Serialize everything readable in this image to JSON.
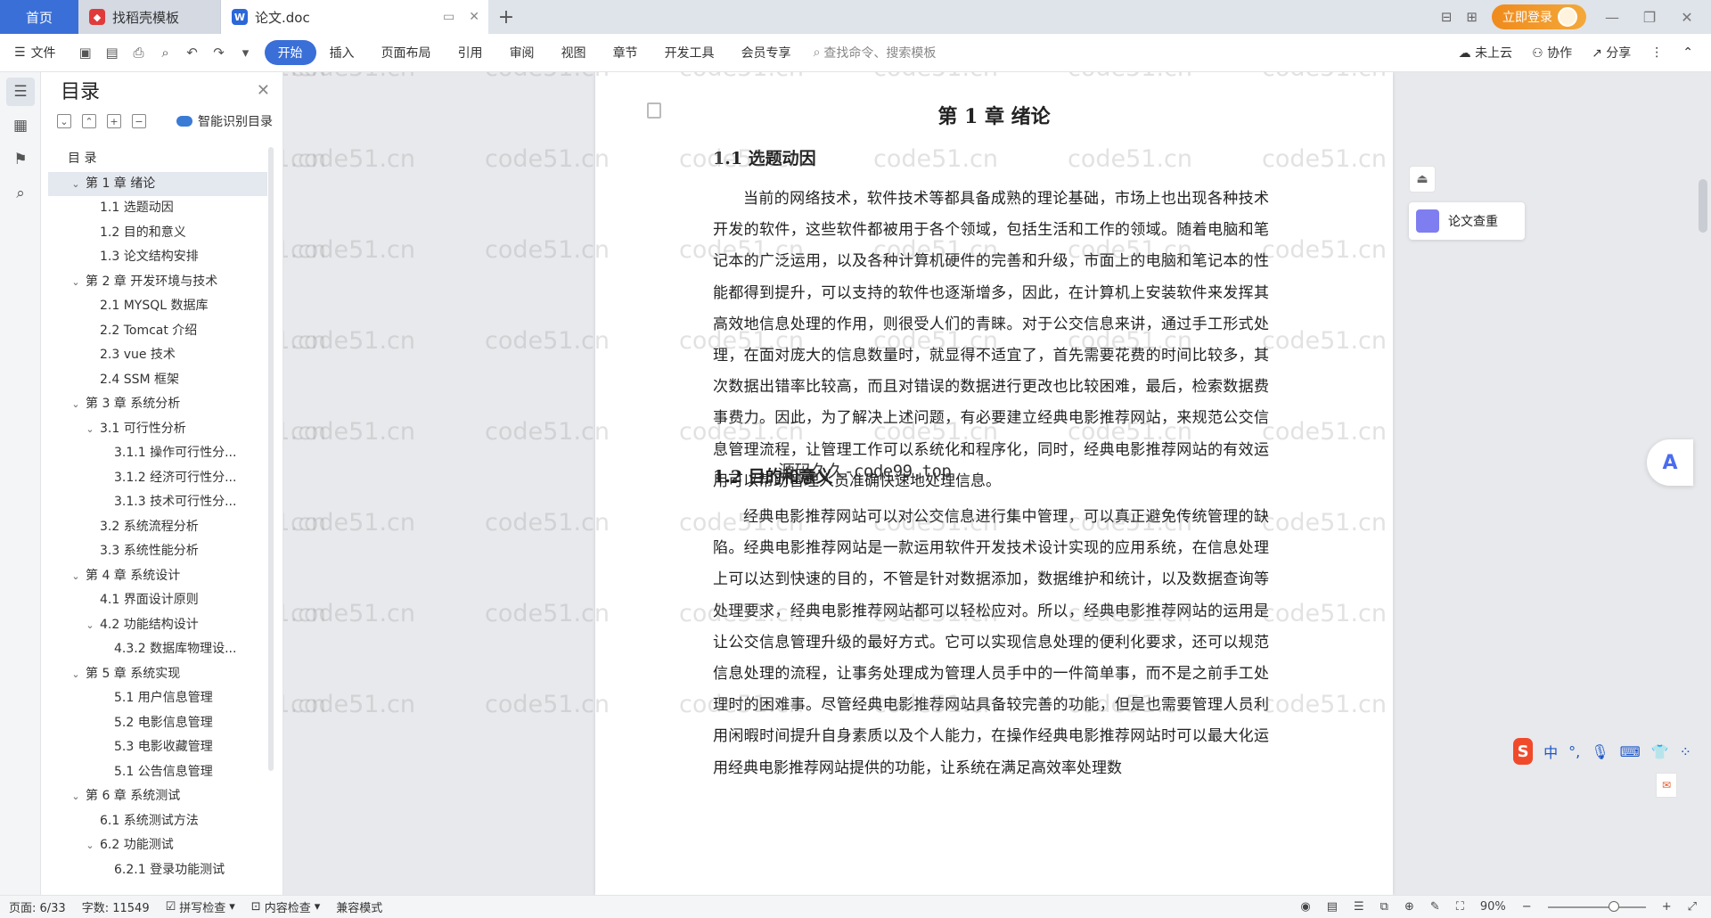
{
  "tabs": {
    "home": "首页",
    "template": "找稻壳模板",
    "doc": "论文.doc",
    "doc_icon": "W"
  },
  "title_right": {
    "login": "立即登录"
  },
  "menubar": {
    "file": "文件",
    "tabs": [
      "开始",
      "插入",
      "页面布局",
      "引用",
      "审阅",
      "视图",
      "章节",
      "开发工具",
      "会员专享"
    ],
    "active_tab": "开始",
    "search_placeholder": "查找命令、搜索模板",
    "cloud": "未上云",
    "collab": "协作",
    "share": "分享"
  },
  "toc": {
    "title": "目录",
    "smart": "智能识别目录",
    "items": [
      {
        "label": "目  录",
        "level": 0,
        "caret": ""
      },
      {
        "label": "第 1 章  绪论",
        "level": 0,
        "caret": "down",
        "selected": true
      },
      {
        "label": "1.1 选题动因",
        "level": 1,
        "caret": ""
      },
      {
        "label": "1.2 目的和意义",
        "level": 1,
        "caret": ""
      },
      {
        "label": "1.3 论文结构安排",
        "level": 1,
        "caret": ""
      },
      {
        "label": "第 2 章  开发环境与技术",
        "level": 0,
        "caret": "down"
      },
      {
        "label": "2.1 MYSQL 数据库",
        "level": 1,
        "caret": ""
      },
      {
        "label": "2.2 Tomcat  介绍",
        "level": 1,
        "caret": ""
      },
      {
        "label": "2.3 vue 技术",
        "level": 1,
        "caret": ""
      },
      {
        "label": "2.4 SSM 框架",
        "level": 1,
        "caret": ""
      },
      {
        "label": "第 3 章  系统分析",
        "level": 0,
        "caret": "down"
      },
      {
        "label": "3.1 可行性分析",
        "level": 1,
        "caret": "down"
      },
      {
        "label": "3.1.1 操作可行性分...",
        "level": 2,
        "caret": ""
      },
      {
        "label": "3.1.2 经济可行性分...",
        "level": 2,
        "caret": ""
      },
      {
        "label": "3.1.3 技术可行性分...",
        "level": 2,
        "caret": ""
      },
      {
        "label": "3.2 系统流程分析",
        "level": 1,
        "caret": ""
      },
      {
        "label": "3.3 系统性能分析",
        "level": 1,
        "caret": ""
      },
      {
        "label": "第 4 章  系统设计",
        "level": 0,
        "caret": "down"
      },
      {
        "label": "4.1 界面设计原则",
        "level": 1,
        "caret": ""
      },
      {
        "label": "4.2 功能结构设计",
        "level": 1,
        "caret": "down"
      },
      {
        "label": "4.3.2  数据库物理设...",
        "level": 2,
        "caret": ""
      },
      {
        "label": "第 5 章  系统实现",
        "level": 0,
        "caret": "down"
      },
      {
        "label": "5.1 用户信息管理",
        "level": 2,
        "caret": ""
      },
      {
        "label": "5.2  电影信息管理",
        "level": 2,
        "caret": ""
      },
      {
        "label": "5.3 电影收藏管理",
        "level": 2,
        "caret": ""
      },
      {
        "label": "5.1 公告信息管理",
        "level": 2,
        "caret": ""
      },
      {
        "label": "第 6 章  系统测试",
        "level": 0,
        "caret": "down"
      },
      {
        "label": "6.1  系统测试方法",
        "level": 1,
        "caret": ""
      },
      {
        "label": "6.2  功能测试",
        "level": 1,
        "caret": "down"
      },
      {
        "label": "6.2.1  登录功能测试",
        "level": 2,
        "caret": ""
      }
    ]
  },
  "document": {
    "chapter_title": "第 1 章  绪论",
    "section1_title": "1.1 选题动因",
    "section1_text": "当前的网络技术，软件技术等都具备成熟的理论基础，市场上也出现各种技术开发的软件，这些软件都被用于各个领域，包括生活和工作的领域。随着电脑和笔记本的广泛运用，以及各种计算机硬件的完善和升级，市面上的电脑和笔记本的性能都得到提升，可以支持的软件也逐渐增多，因此，在计算机上安装软件来发挥其高效地信息处理的作用，则很受人们的青睐。对于公交信息来讲，通过手工形式处理，在面对庞大的信息数量时，就显得不适宜了，首先需要花费的时间比较多，其次数据出错率比较高，而且对错误的数据进行更改也比较困难，最后，检索数据费事费力。因此，为了解决上述问题，有必要建立经典电影推荐网站，来规范公交信息管理流程，让管理工作可以系统化和程序化，同时，经典电影推荐网站的有效运用可以帮助管理人员准确快速地处理信息。",
    "section2_title": "1.2 目的和意义",
    "section2_text": "经典电影推荐网站可以对公交信息进行集中管理，可以真正避免传统管理的缺陷。经典电影推荐网站是一款运用软件开发技术设计实现的应用系统，在信息处理上可以达到快速的目的，不管是针对数据添加，数据维护和统计，以及数据查询等处理要求，经典电影推荐网站都可以轻松应对。所以，经典电影推荐网站的运用是让公交信息管理升级的最好方式。它可以实现信息处理的便利化要求，还可以规范信息处理的流程，让事务处理成为管理人员手中的一件简单事，而不是之前手工处理时的困难事。尽管经典电影推荐网站具备较完善的功能，但是也需要管理人员利用闲暇时间提升自身素质以及个人能力，在操作经典电影推荐网站时可以最大化运用经典电影推荐网站提供的功能，让系统在满足高效率处理数"
  },
  "overlay": {
    "code99": "源码久久-code99.top",
    "thesis_check": "论文查重",
    "watermark": "code51.cn",
    "ime_lang": "中"
  },
  "status": {
    "page": "页面: 6/33",
    "words": "字数: 11549",
    "spell": "拼写检查",
    "content": "内容检查",
    "compat": "兼容模式",
    "zoom": "90%"
  },
  "colors": {
    "accent": "#3a6fd8",
    "login_orange": "#f08a1c"
  }
}
